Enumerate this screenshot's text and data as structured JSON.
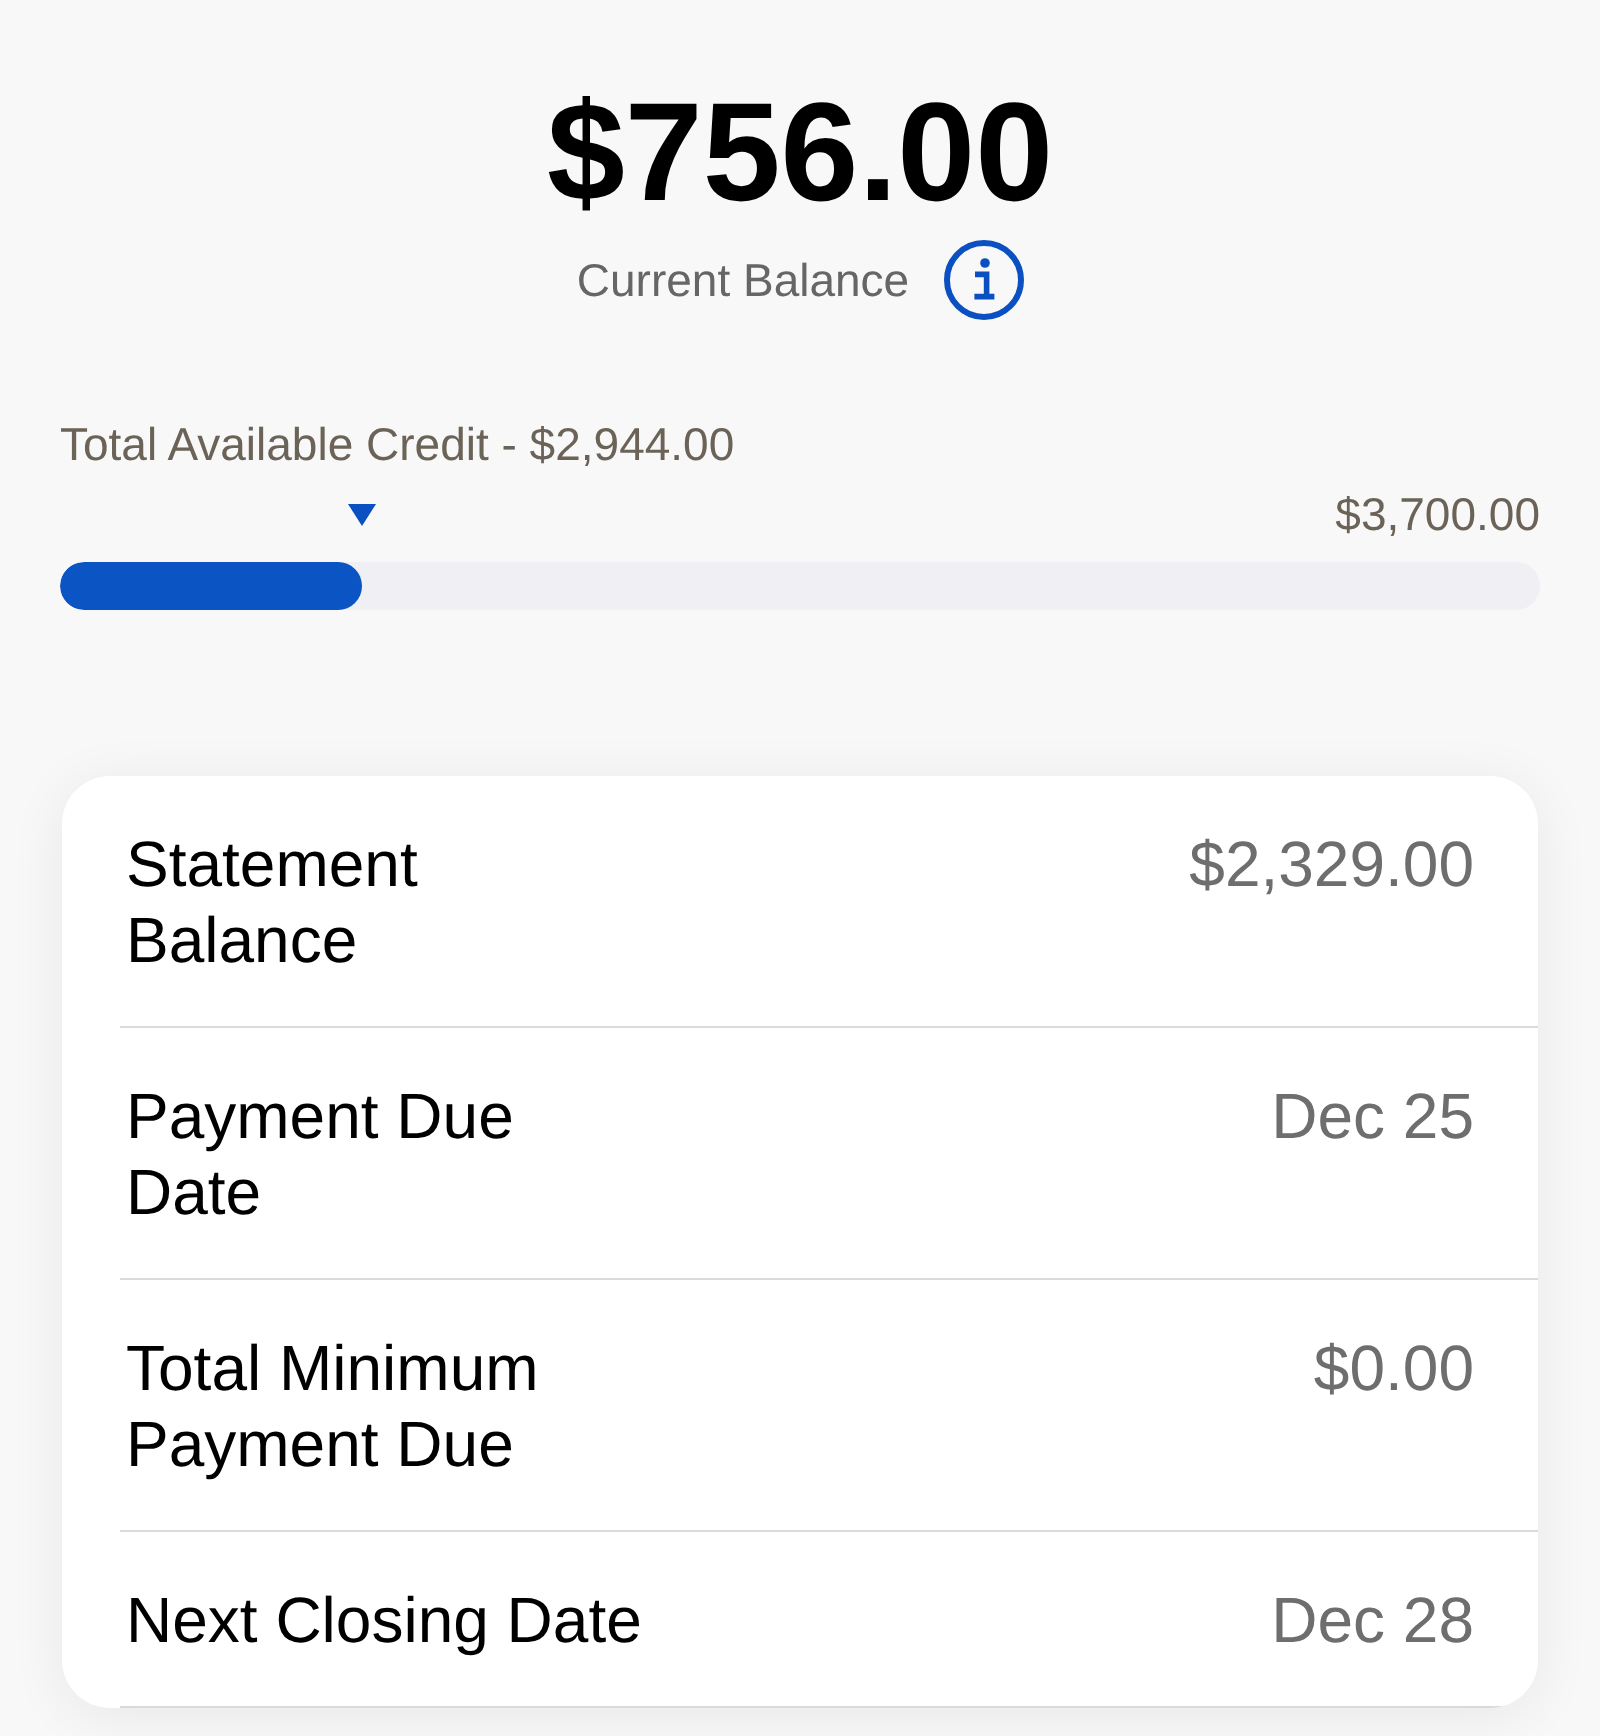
{
  "balance": {
    "amount": "$756.00",
    "label": "Current Balance"
  },
  "credit": {
    "label": "Total Available Credit - $2,944.00",
    "limit": "$3,700.00",
    "level": 0.2043
  },
  "details": [
    {
      "label": "Statement Balance",
      "value": "$2,329.00"
    },
    {
      "label": "Payment Due Date",
      "value": "Dec 25"
    },
    {
      "label": "Total Minimum Payment Due",
      "value": "$0.00"
    },
    {
      "label": "Next Closing Date",
      "value": "Dec 28"
    }
  ]
}
